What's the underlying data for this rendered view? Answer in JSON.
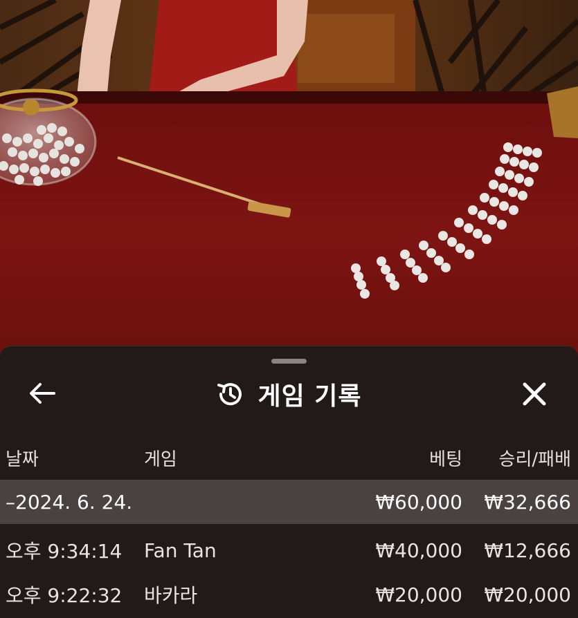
{
  "sheet": {
    "title": "게임 기록",
    "icons": {
      "back": "arrow-left-icon",
      "history": "history-icon",
      "close": "close-icon"
    }
  },
  "table": {
    "columns": {
      "date": "날짜",
      "game": "게임",
      "bet": "베팅",
      "result": "승리/패배"
    },
    "day_group": {
      "date": "–2024. 6. 24.",
      "bet": "₩60,000",
      "result": "₩32,666"
    },
    "rows": [
      {
        "time": "오후 9:34:14",
        "game": "Fan Tan",
        "bet": "₩40,000",
        "result": "₩12,666"
      },
      {
        "time": "오후 9:22:32",
        "game": "바카라",
        "bet": "₩20,000",
        "result": "₩20,000"
      }
    ]
  },
  "colors": {
    "sheet_bg": "#221a19",
    "day_row_bg": "#4a4241",
    "table_felt": "#7a1210",
    "text": "#ffffff"
  }
}
